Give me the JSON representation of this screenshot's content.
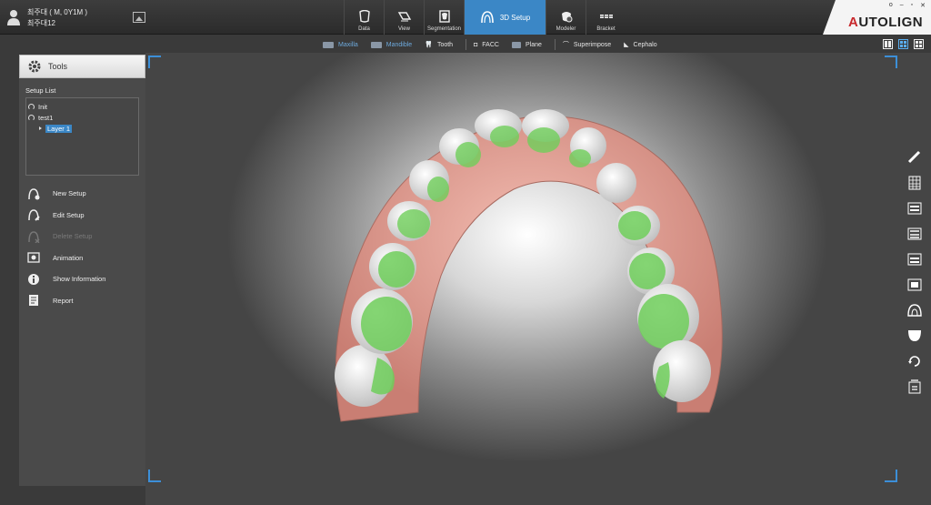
{
  "patient": {
    "line1": "최주대 ( M, 0Y1M )",
    "line2": "최주대12"
  },
  "modules": [
    {
      "label": "Data",
      "icon": "data-icon"
    },
    {
      "label": "View",
      "icon": "view-icon"
    },
    {
      "label": "Segmentation",
      "icon": "segmentation-icon"
    },
    {
      "label": "3D Setup",
      "icon": "arch-icon",
      "active": true
    },
    {
      "label": "Modeler",
      "icon": "modeler-icon"
    },
    {
      "label": "Bracket",
      "icon": "bracket-icon"
    }
  ],
  "brand": {
    "first": "A",
    "rest": "UTOLIGN"
  },
  "window_controls": [
    "o",
    "–",
    "▫",
    "✕"
  ],
  "toolbar2": [
    {
      "label": "Maxilla",
      "dim": true
    },
    {
      "label": "Mandible",
      "dim": true
    },
    {
      "label": "Tooth",
      "dim": false
    },
    {
      "label": "FACC",
      "dim": false
    },
    {
      "label": "Plane",
      "dim": false
    },
    {
      "label": "Superimpose",
      "dim": false
    },
    {
      "label": "Cephalo",
      "dim": false
    }
  ],
  "tools_panel": {
    "title": "Tools",
    "setup_list_title": "Setup List",
    "setup_list": [
      {
        "label": "Init"
      },
      {
        "label": "test1"
      },
      {
        "label": "Layer 1",
        "selected": true
      }
    ],
    "menu": [
      {
        "label": "New Setup",
        "icon": "new-setup-icon",
        "enabled": true
      },
      {
        "label": "Edit Setup",
        "icon": "edit-setup-icon",
        "enabled": true
      },
      {
        "label": "Delete Setup",
        "icon": "delete-setup-icon",
        "enabled": false
      },
      {
        "label": "Animation",
        "icon": "animation-icon",
        "enabled": true
      },
      {
        "label": "Show Information",
        "icon": "info-icon",
        "enabled": true
      },
      {
        "label": "Report",
        "icon": "report-icon",
        "enabled": true
      }
    ]
  },
  "right_tools": [
    "ruler-icon",
    "grid-icon",
    "front-view-icon",
    "top-view-icon",
    "bottom-view-icon",
    "side-view-icon",
    "upper-arch-icon",
    "lower-arch-icon",
    "rotate-icon",
    "export-icon"
  ],
  "colors": {
    "accent": "#3b87c6",
    "gum": "#e8a59a",
    "tooth": "#f2f2f2",
    "overlay": "#6fce5a"
  }
}
